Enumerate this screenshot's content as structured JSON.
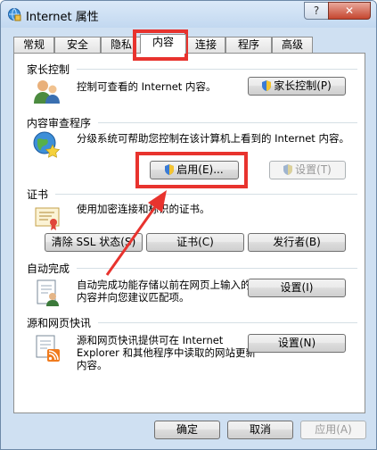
{
  "window": {
    "title": "Internet 属性",
    "help_label": "?",
    "close_label": "✕"
  },
  "tabs": [
    {
      "label": "常规"
    },
    {
      "label": "安全"
    },
    {
      "label": "隐私"
    },
    {
      "label": "内容"
    },
    {
      "label": "连接"
    },
    {
      "label": "程序"
    },
    {
      "label": "高级"
    }
  ],
  "active_tab": "内容",
  "sections": {
    "parental": {
      "title": "家长控制",
      "description": "控制可查看的 Internet 内容。",
      "button": "家长控制(P)"
    },
    "content_advisor": {
      "title": "内容审查程序",
      "description": "分级系统可帮助您控制在该计算机上看到的 Internet 内容。",
      "enable_button": "启用(E)...",
      "settings_button": "设置(T)"
    },
    "certificates": {
      "title": "证书",
      "description": "使用加密连接和标识的证书。",
      "clear_ssl_button": "清除 SSL 状态(S)",
      "certificates_button": "证书(C)",
      "publishers_button": "发行者(B)"
    },
    "autocomplete": {
      "title": "自动完成",
      "description": "自动完成功能存储以前在网页上输入的内容并向您建议匹配项。",
      "button": "设置(I)"
    },
    "feeds": {
      "title": "源和网页快讯",
      "description": "源和网页快讯提供可在 Internet Explorer 和其他程序中读取的网站更新内容。",
      "button": "设置(N)"
    }
  },
  "footer": {
    "ok": "确定",
    "cancel": "取消",
    "apply": "应用(A)"
  },
  "colors": {
    "highlight": "#e8332e",
    "titlebar": "#cfe0f2"
  }
}
